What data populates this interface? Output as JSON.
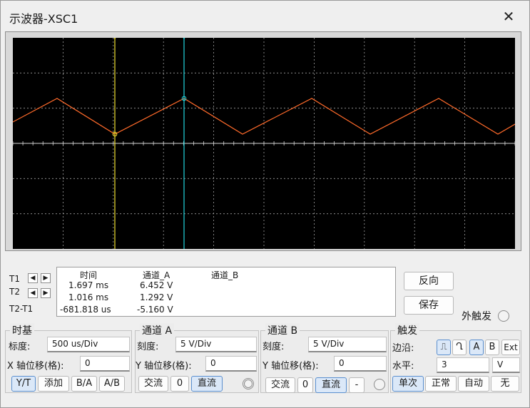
{
  "window": {
    "title": "示波器-XSC1",
    "close_icon": "close-icon"
  },
  "scope": {
    "screen_color": "#000000",
    "grid_color": "#a0a0a0",
    "channel_a_color": "#ff6a2a",
    "cursor1_color": "#f0e030",
    "cursor2_color": "#22d6e0"
  },
  "cursors": {
    "t1_label": "T1",
    "t2_label": "T2",
    "diff_label": "T2-T1",
    "headers": {
      "time": "时间",
      "ch_a": "通道_A",
      "ch_b": "通道_B"
    },
    "rows": [
      {
        "time": "1.697 ms",
        "a": "6.452 V"
      },
      {
        "time": "1.016 ms",
        "a": "1.292 V"
      },
      {
        "time": "-681.818 us",
        "a": "-5.160 V"
      }
    ]
  },
  "actions": {
    "reverse": "反向",
    "save": "保存",
    "ext_trigger": "外触发"
  },
  "timebase": {
    "title": "时基",
    "scale_label": "标度:",
    "scale": "500 us/Div",
    "xpos_label": "X 轴位移(格):",
    "xpos": "0",
    "buttons": [
      "Y/T",
      "添加",
      "B/A",
      "A/B"
    ]
  },
  "channel_a": {
    "title": "通道 A",
    "scale_label": "刻度:",
    "scale": "5  V/Div",
    "ypos_label": "Y 轴位移(格):",
    "ypos": "0",
    "coupling": [
      "交流",
      "0",
      "直流"
    ]
  },
  "channel_b": {
    "title": "通道 B",
    "scale_label": "刻度:",
    "scale": "5  V/Div",
    "ypos_label": "Y 轴位移(格):",
    "ypos": "0",
    "coupling": [
      "交流",
      "0",
      "直流",
      "-"
    ]
  },
  "trigger": {
    "title": "触发",
    "edge_label": "边沿:",
    "edge_rising_icon": "rising-edge-icon",
    "edge_falling_icon": "falling-edge-icon",
    "sources": [
      "A",
      "B",
      "Ext"
    ],
    "level_label": "水平:",
    "level": "3",
    "level_unit": "V",
    "modes": [
      "单次",
      "正常",
      "自动",
      "无"
    ]
  }
}
